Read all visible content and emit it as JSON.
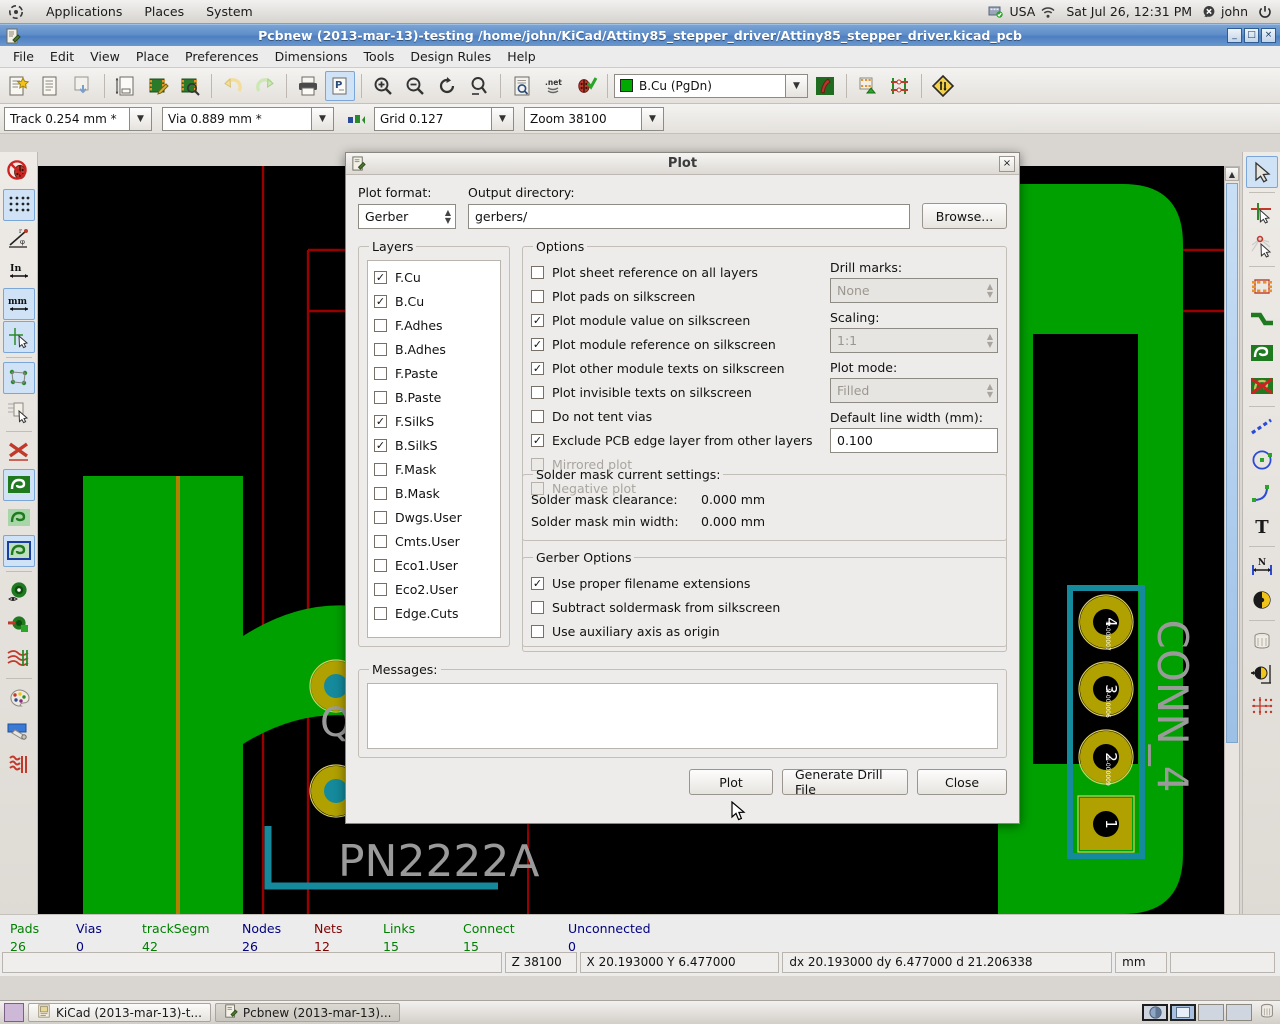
{
  "gnome_panel": {
    "menus": [
      "Applications",
      "Places",
      "System"
    ],
    "keyboard_layout": "USA",
    "clock": "Sat Jul 26, 12:31 PM",
    "user": "john",
    "icons": [
      "ubuntu-logo-icon",
      "network-wired-icon",
      "wifi-icon",
      "user-status-icon",
      "power-icon"
    ]
  },
  "window": {
    "title": "Pcbnew (2013-mar-13)-testing /home/john/KiCad/Attiny85_stepper_driver/Attiny85_stepper_driver.kicad_pcb",
    "minimize": "_",
    "maximize": "□",
    "close": "×"
  },
  "menubar": {
    "items": [
      "File",
      "Edit",
      "View",
      "Place",
      "Preferences",
      "Dimensions",
      "Tools",
      "Design Rules",
      "Help"
    ]
  },
  "toolbar_main": {
    "buttons": [
      "new-board-icon",
      "open-board-icon",
      "save-board-icon",
      "page-settings-icon",
      "open-module-editor-icon",
      "open-module-viewer-icon",
      "undo-icon",
      "redo-icon",
      "print-icon",
      "plot-icon",
      "zoom-in-icon",
      "zoom-out-icon",
      "zoom-redraw-icon",
      "zoom-fit-icon",
      "find-icon",
      "netlist-icon",
      "drc-icon"
    ],
    "active_button": "plot-icon"
  },
  "layer_selector": {
    "value": "B.Cu (PgDn)",
    "swatch_color": "#00aa00"
  },
  "toolbar_aux": {
    "track_width": "Track 0.254 mm *",
    "via_size": "Via 0.889 mm *",
    "grid": "Grid 0.127",
    "zoom": "Zoom 38100"
  },
  "left_toolbar": {
    "items": [
      "drc-off-icon",
      "grid-toggle-icon",
      "polar-coords-icon",
      "units-inch-icon",
      "units-mm-icon",
      "cursor-shape-icon",
      "show-ratsnest-icon",
      "module-ratsnest-icon",
      "auto-delete-track-icon",
      "show-filled-zones-icon",
      "show-outline-zones-icon",
      "show-sketch-zones-icon",
      "pads-sketch-icon",
      "vias-sketch-icon",
      "tracks-sketch-icon",
      "palette-icon",
      "high-contrast-icon",
      "layer-manager-icon"
    ]
  },
  "right_toolbar": {
    "items": [
      "select-tool-icon",
      "highlight-net-icon",
      "local-ratsnest-icon",
      "add-module-icon",
      "add-track-icon",
      "add-zone-icon",
      "delete-zone-icon",
      "add-line-icon",
      "add-circle-icon",
      "add-arc-icon",
      "add-text-icon",
      "add-dimension-icon",
      "add-target-icon",
      "delete-item-icon",
      "offset-origin-icon",
      "grid-origin-icon"
    ],
    "active_item": "select-tool-icon"
  },
  "pcb_canvas": {
    "components": [
      {
        "ref": "CONN_4",
        "pads": [
          "4",
          "3",
          "2",
          "1"
        ],
        "pad_nets": [
          "N-000007",
          "N-000006",
          "N-000009",
          ""
        ]
      },
      {
        "ref": "PN2222A",
        "pads": []
      }
    ],
    "colors": {
      "background": "#000000",
      "copper_b": "#00a000",
      "pad": "#b0a000",
      "silkscreen": "#9a9a9a",
      "edge_cuts": "#9b0000",
      "selection": "#148a9c",
      "track_f": "#b08000"
    }
  },
  "plot_dialog": {
    "title": "Plot",
    "close_label": "×",
    "plot_format_label": "Plot format:",
    "plot_format_value": "Gerber",
    "output_dir_label": "Output directory:",
    "output_dir_value": "gerbers/",
    "browse_label": "Browse...",
    "layers": {
      "legend": "Layers",
      "items": [
        {
          "name": "F.Cu",
          "checked": true
        },
        {
          "name": "B.Cu",
          "checked": true
        },
        {
          "name": "F.Adhes",
          "checked": false
        },
        {
          "name": "B.Adhes",
          "checked": false
        },
        {
          "name": "F.Paste",
          "checked": false
        },
        {
          "name": "B.Paste",
          "checked": false
        },
        {
          "name": "F.SilkS",
          "checked": true
        },
        {
          "name": "B.SilkS",
          "checked": true
        },
        {
          "name": "F.Mask",
          "checked": false
        },
        {
          "name": "B.Mask",
          "checked": false
        },
        {
          "name": "Dwgs.User",
          "checked": false
        },
        {
          "name": "Cmts.User",
          "checked": false
        },
        {
          "name": "Eco1.User",
          "checked": false
        },
        {
          "name": "Eco2.User",
          "checked": false
        },
        {
          "name": "Edge.Cuts",
          "checked": false
        }
      ]
    },
    "options": {
      "legend": "Options",
      "items": [
        {
          "label": "Plot sheet reference on all layers",
          "checked": false,
          "enabled": true
        },
        {
          "label": "Plot pads on silkscreen",
          "checked": false,
          "enabled": true
        },
        {
          "label": "Plot module value on silkscreen",
          "checked": true,
          "enabled": true
        },
        {
          "label": "Plot module reference on silkscreen",
          "checked": true,
          "enabled": true
        },
        {
          "label": "Plot other module texts on silkscreen",
          "checked": true,
          "enabled": true
        },
        {
          "label": "Plot invisible texts on silkscreen",
          "checked": false,
          "enabled": true
        },
        {
          "label": "Do not tent vias",
          "checked": false,
          "enabled": true
        },
        {
          "label": "Exclude PCB edge layer from other layers",
          "checked": true,
          "enabled": true
        },
        {
          "label": "Mirrored plot",
          "checked": false,
          "enabled": false
        },
        {
          "label": "Negative plot",
          "checked": false,
          "enabled": false
        }
      ],
      "drill_marks_label": "Drill marks:",
      "drill_marks_value": "None",
      "scaling_label": "Scaling:",
      "scaling_value": "1:1",
      "plot_mode_label": "Plot mode:",
      "plot_mode_value": "Filled",
      "line_width_label": "Default line width (mm):",
      "line_width_value": "0.100"
    },
    "solder_mask": {
      "legend": "Solder mask current settings:",
      "clearance_label": "Solder mask clearance:",
      "clearance_value": "0.000 mm",
      "min_width_label": "Solder mask min width:",
      "min_width_value": "0.000 mm"
    },
    "gerber_options": {
      "legend": "Gerber Options",
      "items": [
        {
          "label": "Use proper filename extensions",
          "checked": true
        },
        {
          "label": "Subtract soldermask from silkscreen",
          "checked": false
        },
        {
          "label": "Use auxiliary axis as origin",
          "checked": false
        }
      ]
    },
    "messages": {
      "legend": "Messages:",
      "text": ""
    },
    "buttons": {
      "plot": "Plot",
      "generate_drill": "Generate Drill File",
      "close": "Close"
    }
  },
  "statusbar": {
    "counts": [
      {
        "label": "Pads",
        "value": "26",
        "color": "#008000"
      },
      {
        "label": "Vias",
        "value": "0",
        "color": "#000080"
      },
      {
        "label": "trackSegm",
        "value": "42",
        "color": "#008000"
      },
      {
        "label": "Nodes",
        "value": "26",
        "color": "#000080"
      },
      {
        "label": "Nets",
        "value": "12",
        "color": "#800000"
      },
      {
        "label": "Links",
        "value": "15",
        "color": "#008000"
      },
      {
        "label": "Connect",
        "value": "15",
        "color": "#008000"
      },
      {
        "label": "Unconnected",
        "value": "0",
        "color": "#000080"
      }
    ],
    "fields": {
      "blank": "",
      "zoom": "Z 38100",
      "position": "X 20.193000  Y 6.477000",
      "delta": "dx 20.193000  dy 6.477000  d 21.206338",
      "units": "mm"
    }
  },
  "taskbar": {
    "items": [
      {
        "label": "KiCad (2013-mar-13)-t...",
        "icon": "kicad-icon",
        "active": false
      },
      {
        "label": "Pcbnew (2013-mar-13)...",
        "icon": "pcbnew-icon",
        "active": true
      }
    ],
    "workspaces": 4,
    "selected_workspace": 2,
    "trash_icon": "trash-icon"
  }
}
